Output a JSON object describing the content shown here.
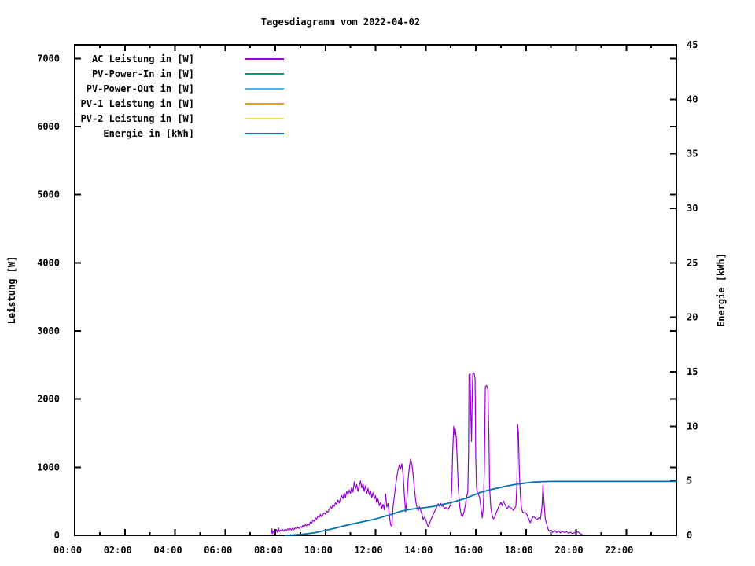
{
  "chart_data": {
    "type": "line",
    "title": "Tagesdiagramm vom 2022-04-02",
    "xlabel": "",
    "ylabel": "Leistung [W]",
    "y2label": "Energie [kWh]",
    "xlim": [
      0,
      24
    ],
    "ylim": [
      0,
      7200
    ],
    "y2lim": [
      0,
      45
    ],
    "grid": false,
    "legend_position": "top-left-inside",
    "background": "#ffffff",
    "x_major_ticks": [
      {
        "h": 0,
        "label": "00:00"
      },
      {
        "h": 2,
        "label": "02:00"
      },
      {
        "h": 4,
        "label": "04:00"
      },
      {
        "h": 6,
        "label": "06:00"
      },
      {
        "h": 8,
        "label": "08:00"
      },
      {
        "h": 10,
        "label": "10:00"
      },
      {
        "h": 12,
        "label": "12:00"
      },
      {
        "h": 14,
        "label": "14:00"
      },
      {
        "h": 16,
        "label": "16:00"
      },
      {
        "h": 18,
        "label": "18:00"
      },
      {
        "h": 20,
        "label": "20:00"
      },
      {
        "h": 22,
        "label": "22:00"
      },
      {
        "h": 24,
        "label": ""
      }
    ],
    "x_minor_ticks": [
      1,
      3,
      5,
      7,
      9,
      11,
      13,
      15,
      17,
      19,
      21,
      23
    ],
    "y_ticks": [
      {
        "v": 0,
        "label": "0"
      },
      {
        "v": 1000,
        "label": "1000"
      },
      {
        "v": 2000,
        "label": "2000"
      },
      {
        "v": 3000,
        "label": "3000"
      },
      {
        "v": 4000,
        "label": "4000"
      },
      {
        "v": 5000,
        "label": "5000"
      },
      {
        "v": 6000,
        "label": "6000"
      },
      {
        "v": 7000,
        "label": "7000"
      }
    ],
    "y2_ticks": [
      {
        "v": 0,
        "label": "0"
      },
      {
        "v": 5,
        "label": "5"
      },
      {
        "v": 10,
        "label": "10"
      },
      {
        "v": 15,
        "label": "15"
      },
      {
        "v": 20,
        "label": "20"
      },
      {
        "v": 25,
        "label": "25"
      },
      {
        "v": 30,
        "label": "30"
      },
      {
        "v": 35,
        "label": "35"
      },
      {
        "v": 40,
        "label": "40"
      },
      {
        "v": 45,
        "label": "45"
      }
    ],
    "series": [
      {
        "name": "AC Leistung in [W]",
        "axis": "left",
        "color": "#9400d3",
        "points": [
          [
            7.82,
            5
          ],
          [
            7.85,
            60
          ],
          [
            7.87,
            95
          ],
          [
            7.89,
            25
          ],
          [
            7.93,
            60
          ],
          [
            7.97,
            40
          ],
          [
            8.0,
            65
          ],
          [
            8.04,
            85
          ],
          [
            8.08,
            45
          ],
          [
            8.12,
            110
          ],
          [
            8.16,
            55
          ],
          [
            8.2,
            80
          ],
          [
            8.25,
            65
          ],
          [
            8.3,
            85
          ],
          [
            8.35,
            60
          ],
          [
            8.4,
            90
          ],
          [
            8.45,
            70
          ],
          [
            8.5,
            95
          ],
          [
            8.55,
            75
          ],
          [
            8.6,
            100
          ],
          [
            8.65,
            80
          ],
          [
            8.7,
            105
          ],
          [
            8.75,
            85
          ],
          [
            8.8,
            110
          ],
          [
            8.85,
            95
          ],
          [
            8.9,
            120
          ],
          [
            8.95,
            100
          ],
          [
            9.0,
            130
          ],
          [
            9.05,
            115
          ],
          [
            9.1,
            145
          ],
          [
            9.15,
            125
          ],
          [
            9.2,
            155
          ],
          [
            9.25,
            140
          ],
          [
            9.3,
            170
          ],
          [
            9.35,
            150
          ],
          [
            9.4,
            195
          ],
          [
            9.45,
            175
          ],
          [
            9.5,
            225
          ],
          [
            9.55,
            205
          ],
          [
            9.6,
            255
          ],
          [
            9.65,
            235
          ],
          [
            9.7,
            285
          ],
          [
            9.75,
            260
          ],
          [
            9.8,
            310
          ],
          [
            9.85,
            275
          ],
          [
            9.9,
            305
          ],
          [
            9.95,
            330
          ],
          [
            10.0,
            310
          ],
          [
            10.05,
            355
          ],
          [
            10.1,
            340
          ],
          [
            10.15,
            385
          ],
          [
            10.2,
            420
          ],
          [
            10.25,
            395
          ],
          [
            10.3,
            450
          ],
          [
            10.35,
            425
          ],
          [
            10.4,
            480
          ],
          [
            10.45,
            455
          ],
          [
            10.5,
            520
          ],
          [
            10.55,
            475
          ],
          [
            10.6,
            545
          ],
          [
            10.65,
            585
          ],
          [
            10.7,
            540
          ],
          [
            10.75,
            625
          ],
          [
            10.8,
            555
          ],
          [
            10.85,
            645
          ],
          [
            10.9,
            595
          ],
          [
            10.95,
            665
          ],
          [
            11.0,
            615
          ],
          [
            11.05,
            705
          ],
          [
            11.1,
            635
          ],
          [
            11.15,
            785
          ],
          [
            11.2,
            685
          ],
          [
            11.25,
            745
          ],
          [
            11.3,
            645
          ],
          [
            11.35,
            725
          ],
          [
            11.4,
            800
          ],
          [
            11.45,
            695
          ],
          [
            11.5,
            760
          ],
          [
            11.55,
            645
          ],
          [
            11.6,
            725
          ],
          [
            11.65,
            615
          ],
          [
            11.7,
            690
          ],
          [
            11.75,
            595
          ],
          [
            11.8,
            655
          ],
          [
            11.85,
            555
          ],
          [
            11.9,
            625
          ],
          [
            11.95,
            535
          ],
          [
            12.0,
            585
          ],
          [
            12.05,
            475
          ],
          [
            12.1,
            535
          ],
          [
            12.15,
            435
          ],
          [
            12.2,
            485
          ],
          [
            12.25,
            395
          ],
          [
            12.3,
            455
          ],
          [
            12.35,
            375
          ],
          [
            12.4,
            610
          ],
          [
            12.45,
            415
          ],
          [
            12.5,
            470
          ],
          [
            12.55,
            290
          ],
          [
            12.6,
            155
          ],
          [
            12.65,
            130
          ],
          [
            12.7,
            430
          ],
          [
            12.75,
            570
          ],
          [
            12.8,
            720
          ],
          [
            12.85,
            860
          ],
          [
            12.9,
            960
          ],
          [
            12.95,
            1035
          ],
          [
            13.0,
            975
          ],
          [
            13.05,
            1050
          ],
          [
            13.1,
            890
          ],
          [
            13.15,
            590
          ],
          [
            13.2,
            345
          ],
          [
            13.25,
            510
          ],
          [
            13.3,
            820
          ],
          [
            13.35,
            1010
          ],
          [
            13.4,
            1120
          ],
          [
            13.45,
            1040
          ],
          [
            13.5,
            890
          ],
          [
            13.55,
            690
          ],
          [
            13.6,
            510
          ],
          [
            13.65,
            410
          ],
          [
            13.7,
            360
          ],
          [
            13.75,
            420
          ],
          [
            13.8,
            370
          ],
          [
            13.85,
            310
          ],
          [
            13.9,
            230
          ],
          [
            13.95,
            265
          ],
          [
            14.0,
            235
          ],
          [
            14.05,
            175
          ],
          [
            14.1,
            125
          ],
          [
            14.15,
            165
          ],
          [
            14.2,
            225
          ],
          [
            14.3,
            305
          ],
          [
            14.4,
            385
          ],
          [
            14.5,
            465
          ],
          [
            14.55,
            425
          ],
          [
            14.6,
            470
          ],
          [
            14.65,
            430
          ],
          [
            14.7,
            430
          ],
          [
            14.75,
            390
          ],
          [
            14.8,
            410
          ],
          [
            14.9,
            380
          ],
          [
            14.95,
            420
          ],
          [
            15.0,
            450
          ],
          [
            15.04,
            700
          ],
          [
            15.08,
            1250
          ],
          [
            15.12,
            1600
          ],
          [
            15.15,
            1480
          ],
          [
            15.18,
            1565
          ],
          [
            15.22,
            1430
          ],
          [
            15.26,
            1100
          ],
          [
            15.3,
            700
          ],
          [
            15.36,
            420
          ],
          [
            15.42,
            300
          ],
          [
            15.47,
            276
          ],
          [
            15.52,
            330
          ],
          [
            15.58,
            440
          ],
          [
            15.63,
            552
          ],
          [
            15.68,
            640
          ],
          [
            15.71,
            1200
          ],
          [
            15.73,
            2360
          ],
          [
            15.77,
            2370
          ],
          [
            15.8,
            1800
          ],
          [
            15.83,
            1380
          ],
          [
            15.86,
            2100
          ],
          [
            15.88,
            2375
          ],
          [
            15.93,
            2380
          ],
          [
            15.97,
            2300
          ],
          [
            16.0,
            1100
          ],
          [
            16.03,
            700
          ],
          [
            16.07,
            620
          ],
          [
            16.1,
            600
          ],
          [
            16.15,
            560
          ],
          [
            16.2,
            420
          ],
          [
            16.26,
            255
          ],
          [
            16.3,
            400
          ],
          [
            16.34,
            950
          ],
          [
            16.38,
            2180
          ],
          [
            16.43,
            2200
          ],
          [
            16.48,
            2150
          ],
          [
            16.52,
            1500
          ],
          [
            16.55,
            700
          ],
          [
            16.6,
            400
          ],
          [
            16.65,
            300
          ],
          [
            16.7,
            240
          ],
          [
            16.75,
            260
          ],
          [
            16.8,
            320
          ],
          [
            16.9,
            405
          ],
          [
            17.0,
            485
          ],
          [
            17.05,
            435
          ],
          [
            17.1,
            505
          ],
          [
            17.15,
            465
          ],
          [
            17.2,
            425
          ],
          [
            17.25,
            385
          ],
          [
            17.3,
            425
          ],
          [
            17.4,
            405
          ],
          [
            17.5,
            365
          ],
          [
            17.55,
            395
          ],
          [
            17.6,
            430
          ],
          [
            17.64,
            740
          ],
          [
            17.67,
            1627
          ],
          [
            17.7,
            1500
          ],
          [
            17.74,
            900
          ],
          [
            17.78,
            590
          ],
          [
            17.82,
            400
          ],
          [
            17.87,
            340
          ],
          [
            17.93,
            334
          ],
          [
            18.0,
            330
          ],
          [
            18.05,
            300
          ],
          [
            18.1,
            250
          ],
          [
            18.17,
            184
          ],
          [
            18.22,
            230
          ],
          [
            18.3,
            280
          ],
          [
            18.38,
            250
          ],
          [
            18.45,
            230
          ],
          [
            18.52,
            260
          ],
          [
            18.58,
            240
          ],
          [
            18.64,
            420
          ],
          [
            18.68,
            738
          ],
          [
            18.72,
            500
          ],
          [
            18.77,
            242
          ],
          [
            18.82,
            180
          ],
          [
            18.87,
            104
          ],
          [
            18.93,
            60
          ],
          [
            19.0,
            80
          ],
          [
            19.07,
            45
          ],
          [
            19.15,
            70
          ],
          [
            19.22,
            40
          ],
          [
            19.3,
            65
          ],
          [
            19.38,
            35
          ],
          [
            19.45,
            60
          ],
          [
            19.55,
            40
          ],
          [
            19.62,
            55
          ],
          [
            19.7,
            30
          ],
          [
            19.78,
            45
          ],
          [
            19.85,
            28
          ],
          [
            19.93,
            40
          ],
          [
            20.0,
            25
          ],
          [
            20.07,
            55
          ],
          [
            20.15,
            30
          ],
          [
            20.23,
            15
          ]
        ]
      },
      {
        "name": "PV-Power-In in [W]",
        "axis": "left",
        "color": "#009e73",
        "points": []
      },
      {
        "name": "PV-Power-Out in [W]",
        "axis": "left",
        "color": "#56b4e9",
        "points": []
      },
      {
        "name": "PV-1 Leistung in [W]",
        "axis": "left",
        "color": "#e69f00",
        "points": []
      },
      {
        "name": "PV-2 Leistung in [W]",
        "axis": "left",
        "color": "#f0e442",
        "points": []
      },
      {
        "name": "Energie in [kWh]",
        "axis": "right",
        "color": "#0072b2",
        "points": [
          [
            8.4,
            0
          ],
          [
            8.7,
            0.03
          ],
          [
            9.0,
            0.08
          ],
          [
            9.3,
            0.15
          ],
          [
            9.6,
            0.25
          ],
          [
            10.0,
            0.45
          ],
          [
            10.3,
            0.6
          ],
          [
            10.6,
            0.78
          ],
          [
            11.0,
            1.0
          ],
          [
            11.3,
            1.15
          ],
          [
            11.6,
            1.3
          ],
          [
            12.0,
            1.5
          ],
          [
            12.3,
            1.7
          ],
          [
            12.6,
            1.9
          ],
          [
            13.0,
            2.2
          ],
          [
            13.3,
            2.35
          ],
          [
            13.6,
            2.45
          ],
          [
            14.0,
            2.55
          ],
          [
            14.3,
            2.65
          ],
          [
            14.6,
            2.8
          ],
          [
            15.0,
            3.0
          ],
          [
            15.3,
            3.2
          ],
          [
            15.6,
            3.4
          ],
          [
            15.9,
            3.68
          ],
          [
            16.2,
            3.95
          ],
          [
            16.5,
            4.15
          ],
          [
            16.8,
            4.3
          ],
          [
            17.0,
            4.4
          ],
          [
            17.3,
            4.55
          ],
          [
            17.6,
            4.68
          ],
          [
            18.0,
            4.8
          ],
          [
            18.3,
            4.88
          ],
          [
            18.6,
            4.92
          ],
          [
            19.0,
            4.95
          ],
          [
            19.5,
            4.95
          ],
          [
            20.0,
            4.95
          ],
          [
            22.0,
            4.95
          ],
          [
            24.0,
            4.95
          ]
        ]
      }
    ]
  }
}
